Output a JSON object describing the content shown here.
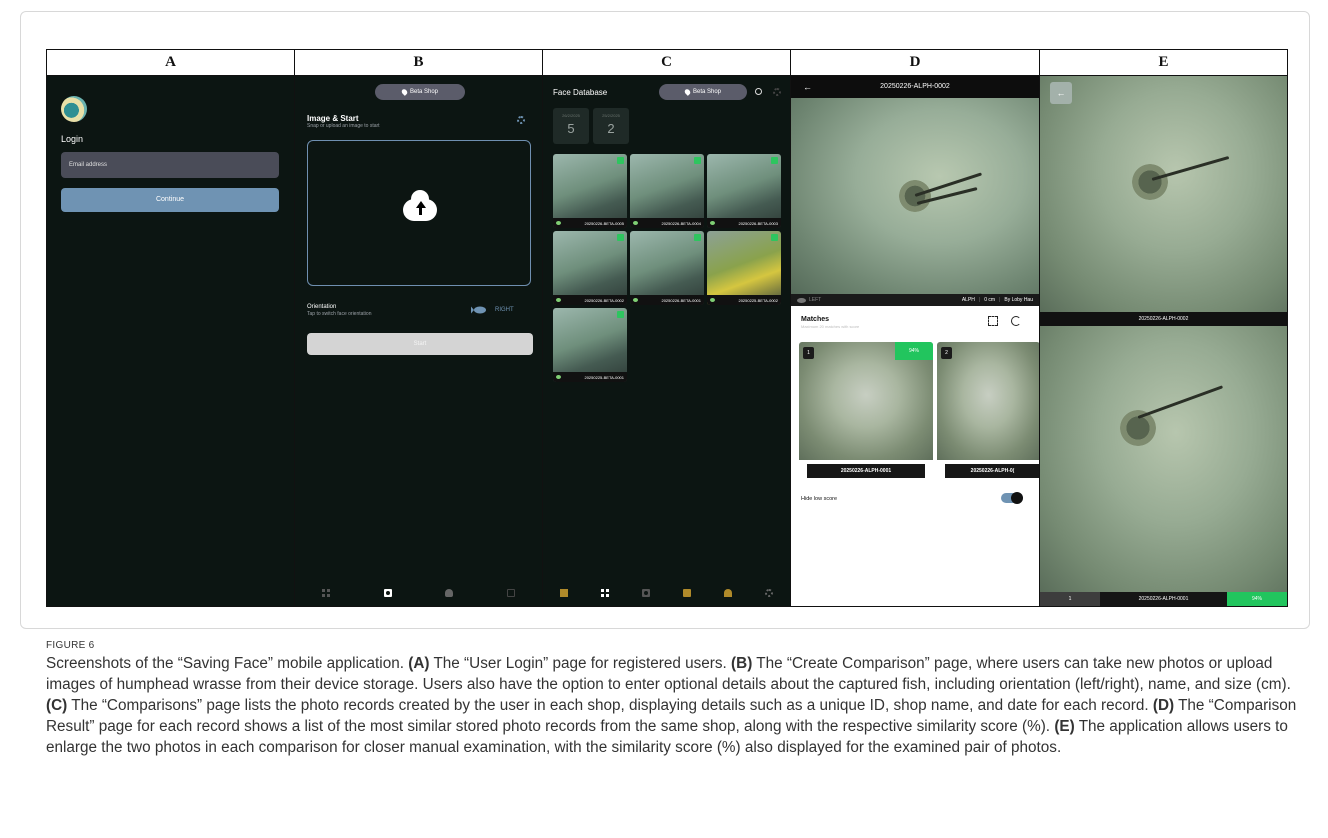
{
  "panels": {
    "a": {
      "letter": "A",
      "login_title": "Login",
      "email_placeholder": "Email address",
      "continue_label": "Continue"
    },
    "b": {
      "letter": "B",
      "shop": "Beta Shop",
      "title": "Image & Start",
      "subtitle": "Snap or upload an image to start",
      "orientation_label": "Orientation",
      "orientation_hint": "Tap to switch face orientation",
      "orientation_value": "RIGHT",
      "start_label": "Start",
      "nav_icons": [
        "grid-icon",
        "camera-icon",
        "cloud-upload-icon",
        "copy-icon"
      ]
    },
    "c": {
      "letter": "C",
      "title": "Face Database",
      "shop": "Beta Shop",
      "dates": [
        {
          "label": "26/2/2025",
          "count": "5"
        },
        {
          "label": "25/2/2025",
          "count": "2"
        }
      ],
      "records": [
        {
          "id": "20250226-BETA-0005"
        },
        {
          "id": "20250226-BETA-0004"
        },
        {
          "id": "20250226-BETA-0003"
        },
        {
          "id": "20250226-BETA-0002"
        },
        {
          "id": "20250226-BETA-0001"
        },
        {
          "id": "20250225-BETA-0002"
        },
        {
          "id": "20250225-BETA-0001"
        }
      ],
      "nav_icons": [
        "inbox-icon",
        "grid-icon",
        "camera-icon",
        "file-icon",
        "users-icon",
        "gear-icon"
      ]
    },
    "d": {
      "letter": "D",
      "record_id": "20250226-ALPH-0002",
      "side": "LEFT",
      "shop_code": "ALPH",
      "size": "0 cm",
      "author": "By Loby Hau",
      "matches_title": "Matches",
      "matches_sub": "Maximum 20 matches with score",
      "matches": [
        {
          "rank": "1",
          "score": "94%",
          "id": "20250226-ALPH-0001"
        },
        {
          "rank": "2",
          "score": "",
          "id": "20250226-ALPH-0("
        }
      ],
      "hide_low_label": "Hide low score",
      "hide_low_on": true
    },
    "e": {
      "letter": "E",
      "top_id": "20250226-ALPH-0002",
      "rank": "1",
      "bottom_id": "20250226-ALPH-0001",
      "score": "94%"
    }
  },
  "caption": {
    "label": "FIGURE 6",
    "intro": "Screenshots of the “Saving Face” mobile application.",
    "a_tag": "(A)",
    "a_text": "The “User Login” page for registered users.",
    "b_tag": "(B)",
    "b_text": "The “Create Comparison” page, where users can take new photos or upload images of humphead wrasse from their device storage. Users also have the option to enter optional details about the captured fish, including orientation (left/right), name, and size (cm).",
    "c_tag": "(C)",
    "c_text": "The “Comparisons” page lists the photo records created by the user in each shop, displaying details such as a unique ID, shop name, and date for each record.",
    "d_tag": "(D)",
    "d_text": "The “Comparison Result” page for each record shows a list of the most similar stored photo records from the same shop, along with the respective similarity score (%).",
    "e_tag": "(E)",
    "e_text": "The application allows users to enlarge the two photos in each comparison for closer manual examination, with the similarity score (%) also displayed for the examined pair of photos."
  },
  "colors": {
    "accent": "#6f93b3",
    "score_green": "#22c55e",
    "app_background": "#0c1512"
  }
}
